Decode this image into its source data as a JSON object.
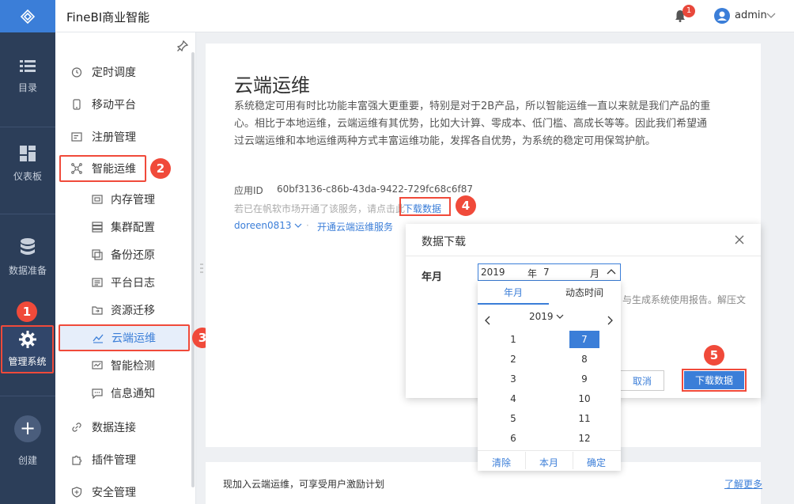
{
  "app": {
    "title": "FineBI商业智能"
  },
  "header": {
    "notification_count": "1",
    "user_name": "admin"
  },
  "rail": {
    "items": [
      {
        "label": "目录"
      },
      {
        "label": "仪表板"
      },
      {
        "label": "数据准备"
      },
      {
        "label": "管理系统"
      }
    ],
    "create_label": "创建"
  },
  "menu": {
    "items": [
      {
        "label": "定时调度"
      },
      {
        "label": "移动平台"
      },
      {
        "label": "注册管理"
      },
      {
        "label": "智能运维"
      }
    ],
    "sub_items": [
      {
        "label": "内存管理"
      },
      {
        "label": "集群配置"
      },
      {
        "label": "备份还原"
      },
      {
        "label": "平台日志"
      },
      {
        "label": "资源迁移"
      },
      {
        "label": "云端运维"
      },
      {
        "label": "智能检测"
      },
      {
        "label": "信息通知"
      }
    ],
    "bottom_items": [
      {
        "label": "数据连接"
      },
      {
        "label": "插件管理"
      },
      {
        "label": "安全管理"
      }
    ]
  },
  "steps": [
    "1",
    "2",
    "3",
    "4",
    "5"
  ],
  "main": {
    "title": "云端运维",
    "description": "系统稳定可用有时比功能丰富强大更重要，特别是对于2B产品，所以智能运维一直以来就是我们产品的重心。相比于本地运维，云端运维有其优势，比如大计算、零成本、低门槛、高成长等等。因此我们希望通过云端运维和本地运维两种方式丰富运维功能，发挥各自优势，为系统的稳定可用保驾护航。",
    "app_id_label": "应用ID",
    "app_id_value": "60bf3136-c86b-43da-9422-729fc68c6f87",
    "hint": "若已在帆软市场开通了该服务，请点击此",
    "download_link": "下载数据",
    "account": "doreen0813",
    "open_service": "开通云端运维服务",
    "footer_text": "现加入云端运维，可享受用户激励计划",
    "footer_link": "了解更多"
  },
  "dialog": {
    "title": "数据下载",
    "field_label": "年月",
    "desc_partial": "与生成系统使用报告。解压文",
    "cancel": "取消",
    "download": "下载数据"
  },
  "picker": {
    "year": "2019",
    "year_unit": "年",
    "month": "7",
    "month_unit": "月",
    "tab_month": "年月",
    "tab_dynamic": "动态时间",
    "nav_year": "2019",
    "months": [
      "1",
      "2",
      "3",
      "4",
      "5",
      "6",
      "7",
      "8",
      "9",
      "10",
      "11",
      "12"
    ],
    "selected_month": "7",
    "clear": "清除",
    "this_month": "本月",
    "confirm": "确定"
  }
}
